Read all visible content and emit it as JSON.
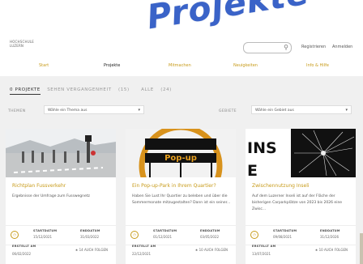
{
  "header": {
    "logo_line1": "HOCHSCHULE",
    "logo_line2": "LUZERN",
    "register": "Registrieren",
    "login": "Anmelden",
    "overlay_title": "Projekte"
  },
  "nav": {
    "items": [
      {
        "label": "Start"
      },
      {
        "label": "Projekte"
      },
      {
        "label": "Mitmachen"
      },
      {
        "label": "Neuigkeiten"
      },
      {
        "label": "Info & Hilfe"
      }
    ]
  },
  "tabs": {
    "projects": "0 PROJEKTE",
    "past_label": "SEHEN VERGANGENHEIT",
    "past_count": "(15)",
    "all_label": "ALLE",
    "all_count": "(24)"
  },
  "filters": {
    "theme_label": "THEMEN",
    "theme_value": "Wähle ein Thema aus",
    "area_label": "GEBIETE",
    "area_value": "Wähle ein Gebiet aus"
  },
  "cards": [
    {
      "title": "Richtplan Fussverkehr",
      "desc": "Ergebnisse der Umfrage zum Fusswegnetz",
      "start_label": "STARTDATUM",
      "start": "15/12/2021",
      "end_label": "ENDDATUM",
      "end": "31/03/2022",
      "created_label": "ERSTELLT AM",
      "created": "06/02/2022",
      "followers": "14",
      "follow_label": "AUCH FOLGEN"
    },
    {
      "title": "Ein Pop-up-Park in Ihrem Quartier?",
      "desc": "Haben Sie Lust Ihr Quartier zu beleben und über die Sommermonate mitzugestalten? Dann ist ein seiner...",
      "start_label": "STARTDATUM",
      "start": "01/12/2021",
      "end_label": "ENDDATUM",
      "end": "03/05/2022",
      "created_label": "ERSTELLT AM",
      "created": "22/12/2021",
      "followers": "10",
      "follow_label": "AUCH FOLGEN"
    },
    {
      "title": "Zwischennutzung Inseli",
      "desc": "Auf dem Luzerner Inseli ist auf der Fläche der bisherigen Carparkplätze von 2023 bis 2026 eine Zwisc...",
      "start_label": "STARTDATUM",
      "start": "09/08/2021",
      "end_label": "ENDDATUM",
      "end": "31/12/2026",
      "created_label": "ERSTELLT AM",
      "created": "13/07/2021",
      "followers": "10",
      "follow_label": "AUCH FOLGEN"
    }
  ],
  "colors": {
    "accent": "#c79a18",
    "overlay_blue": "#3a63c8"
  }
}
